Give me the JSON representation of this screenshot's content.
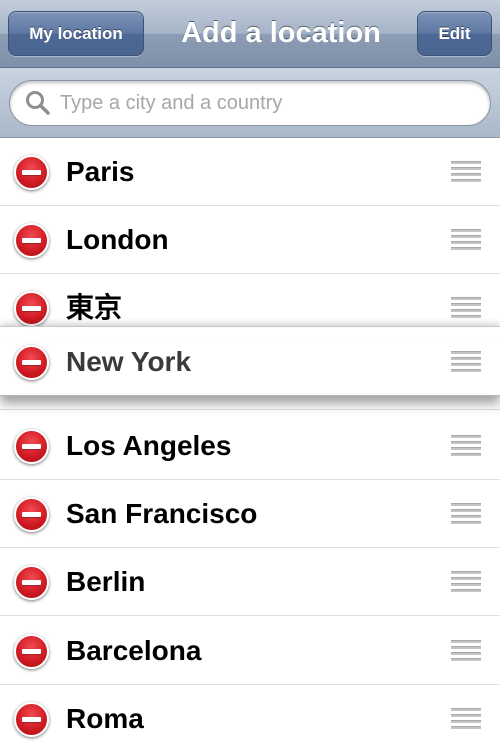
{
  "navbar": {
    "left_button": "My location",
    "title": "Add a location",
    "right_button": "Edit"
  },
  "search": {
    "placeholder": "Type a city and a country",
    "value": ""
  },
  "colors": {
    "delete_red": "#d21c25",
    "nav_button_blue": "#5e78a3"
  },
  "icons": {
    "delete": "minus-circle-icon",
    "reorder": "drag-handle-icon",
    "search": "magnifier-icon"
  },
  "cities": [
    {
      "name": "Paris"
    },
    {
      "name": "London"
    },
    {
      "name": "東京"
    },
    {
      "name": "New York"
    },
    {
      "name": "Los Angeles"
    },
    {
      "name": "San Francisco"
    },
    {
      "name": "Berlin"
    },
    {
      "name": "Barcelona"
    },
    {
      "name": "Roma"
    }
  ]
}
